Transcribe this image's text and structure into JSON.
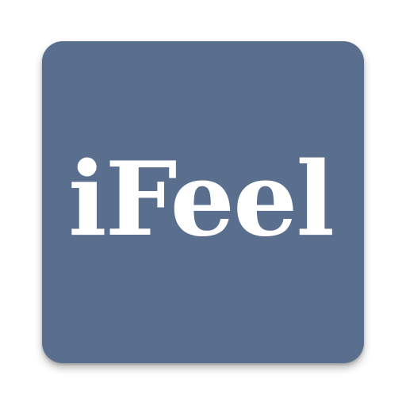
{
  "app_icon": {
    "label": "iFeel",
    "background_color": "#5a6e8e",
    "text_color": "#ffffff"
  }
}
